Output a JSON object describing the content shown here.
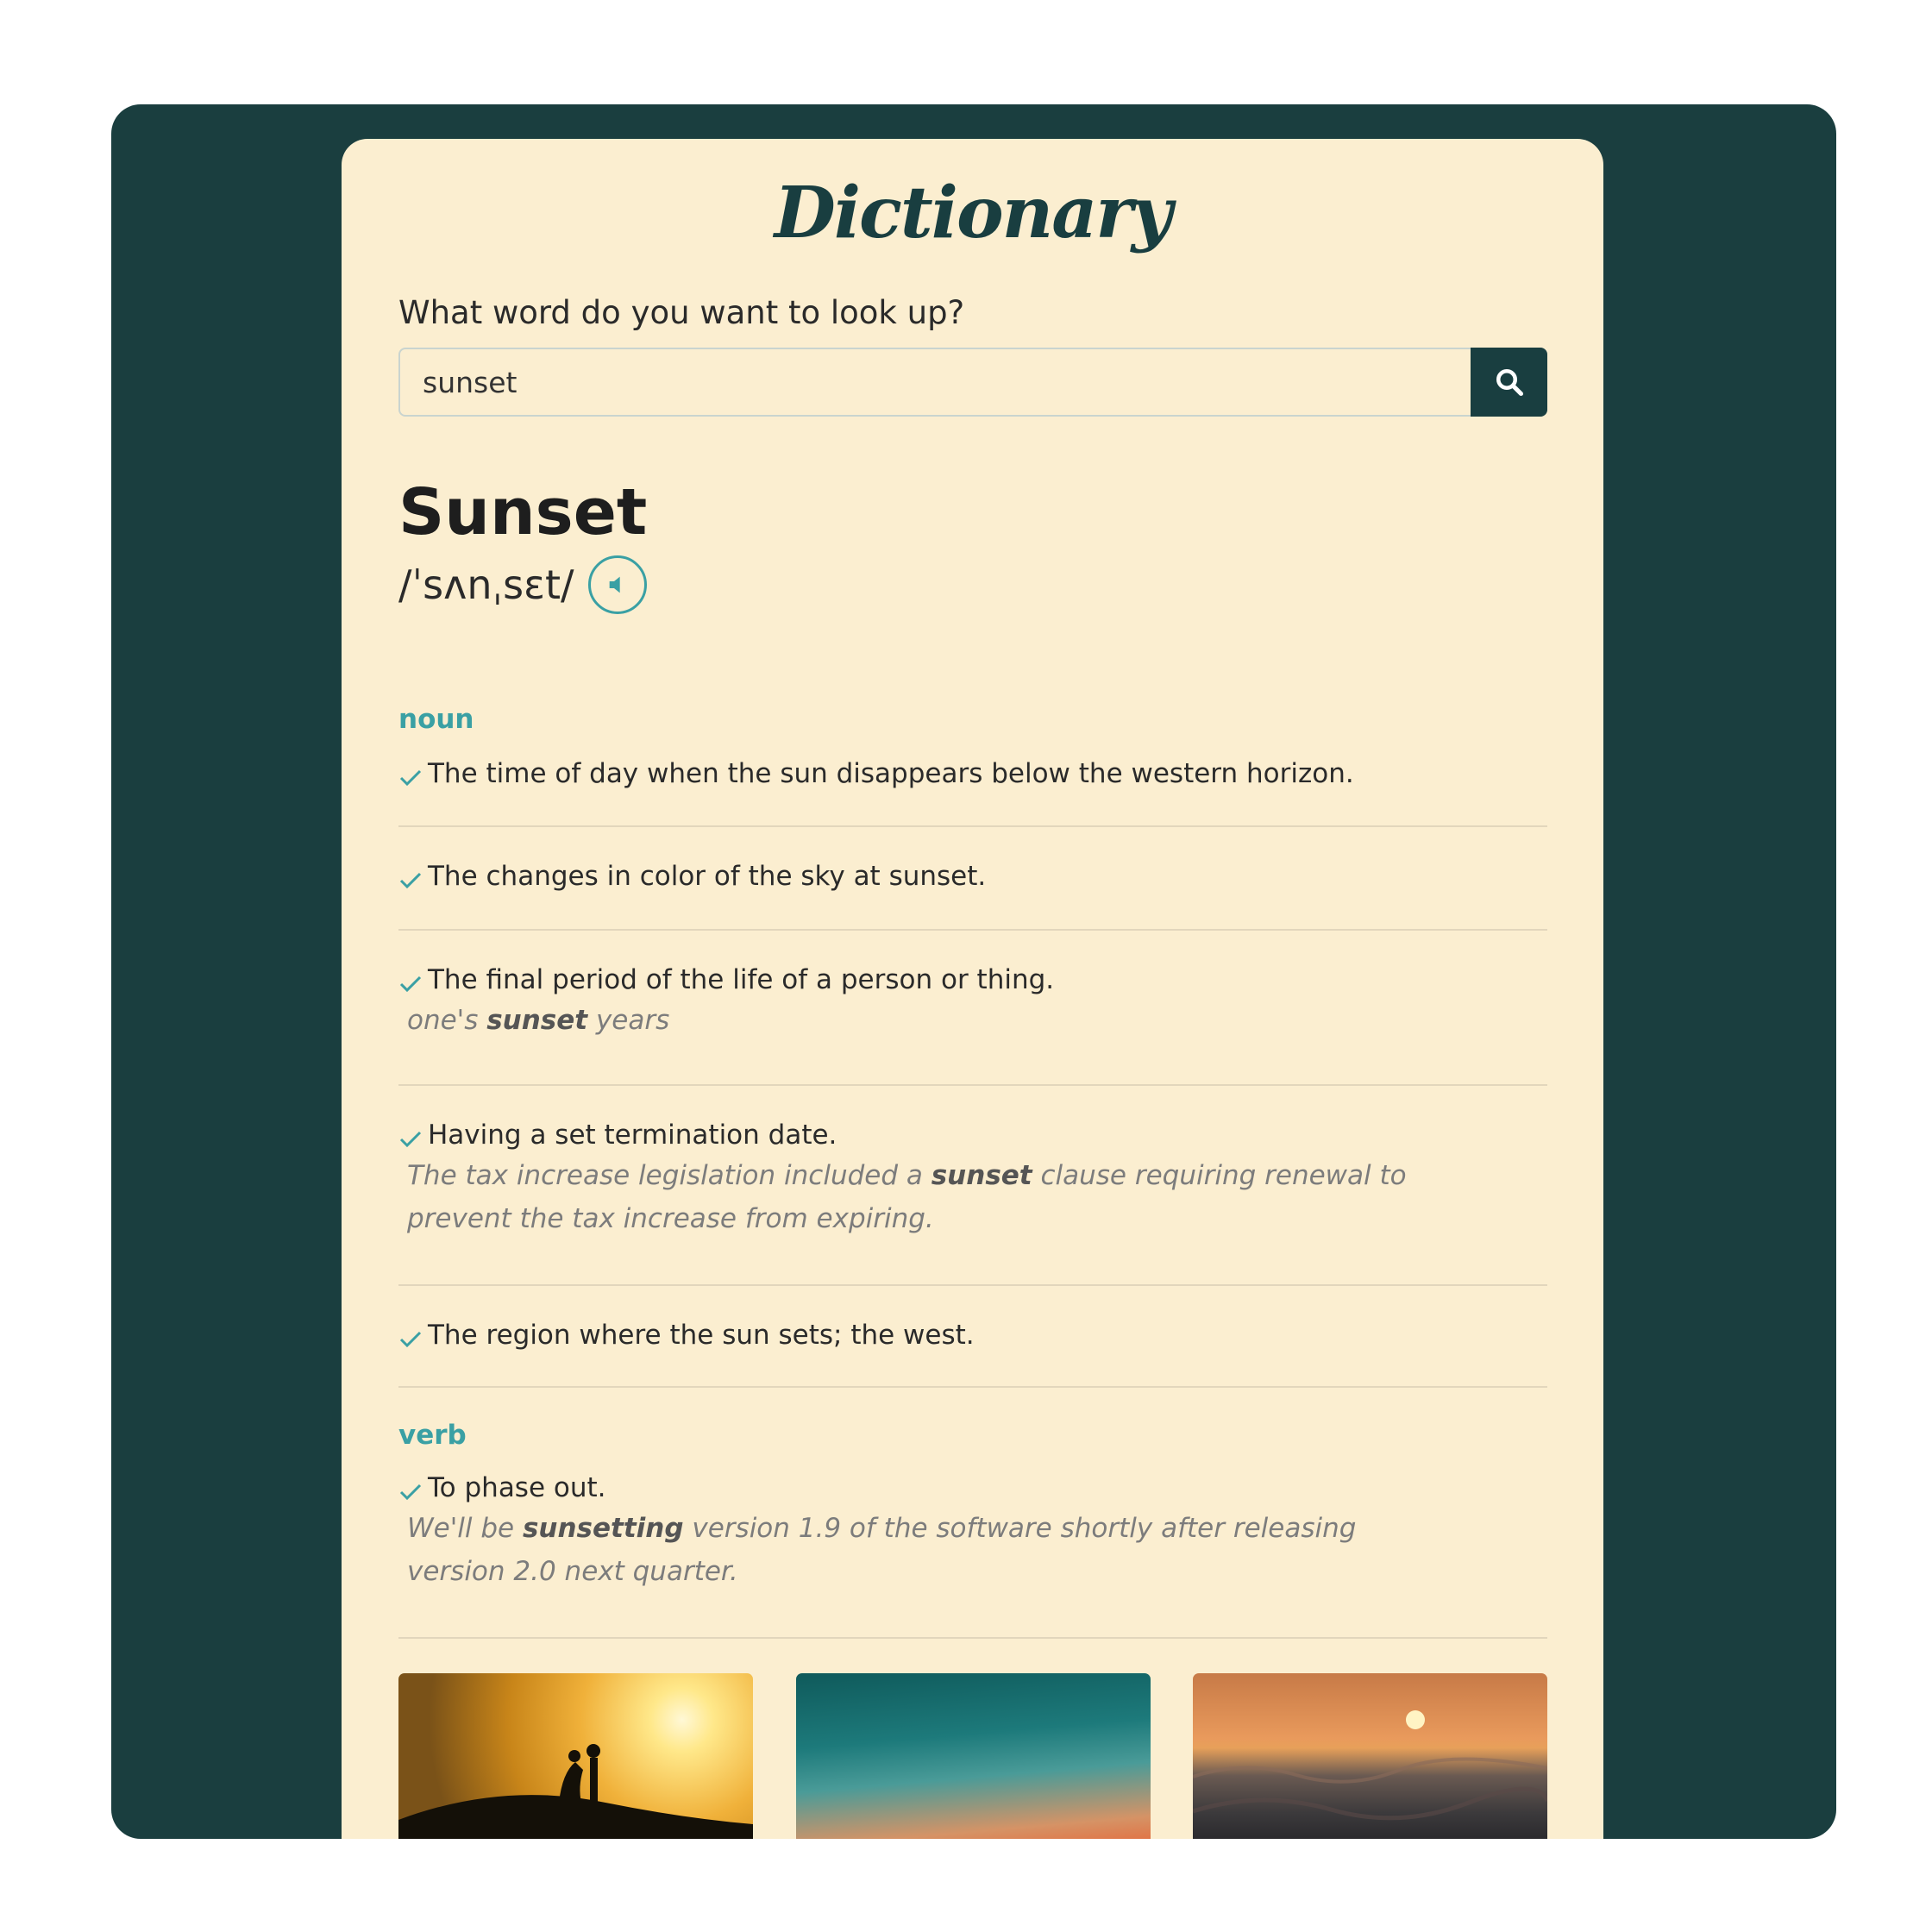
{
  "app": {
    "logo": "Dictionary"
  },
  "search": {
    "prompt": "What word do you want to look up?",
    "value": "sunset",
    "button_icon": "search-icon"
  },
  "entry": {
    "word": "Sunset",
    "phonetic": "/ˈsʌnˌsɛt/",
    "audio_icon": "speaker-icon"
  },
  "meanings": [
    {
      "part_of_speech": "noun",
      "definitions": [
        {
          "text": "The time of day when the sun disappears below the western horizon."
        },
        {
          "text": "The changes in color of the sky at sunset."
        },
        {
          "text": "The final period of the life of a person or thing.",
          "example_pre": "one's ",
          "example_word": "sunset",
          "example_post": " years"
        },
        {
          "text": "Having a set termination date.",
          "example_pre": "The tax increase legislation included a ",
          "example_word": "sunset",
          "example_post": " clause requiring renewal to prevent the tax increase from expiring."
        },
        {
          "text": "The region where the sun sets; the west."
        }
      ]
    },
    {
      "part_of_speech": "verb",
      "definitions": [
        {
          "text": "To phase out.",
          "example_pre": "We'll be ",
          "example_word": "sunsetting",
          "example_post": " version 1.9 of the software shortly after releasing version 2.0 next quarter."
        }
      ]
    }
  ],
  "colors": {
    "frame": "#1a3e3f",
    "card": "#fbeed0",
    "accent": "#3aa0a4"
  }
}
